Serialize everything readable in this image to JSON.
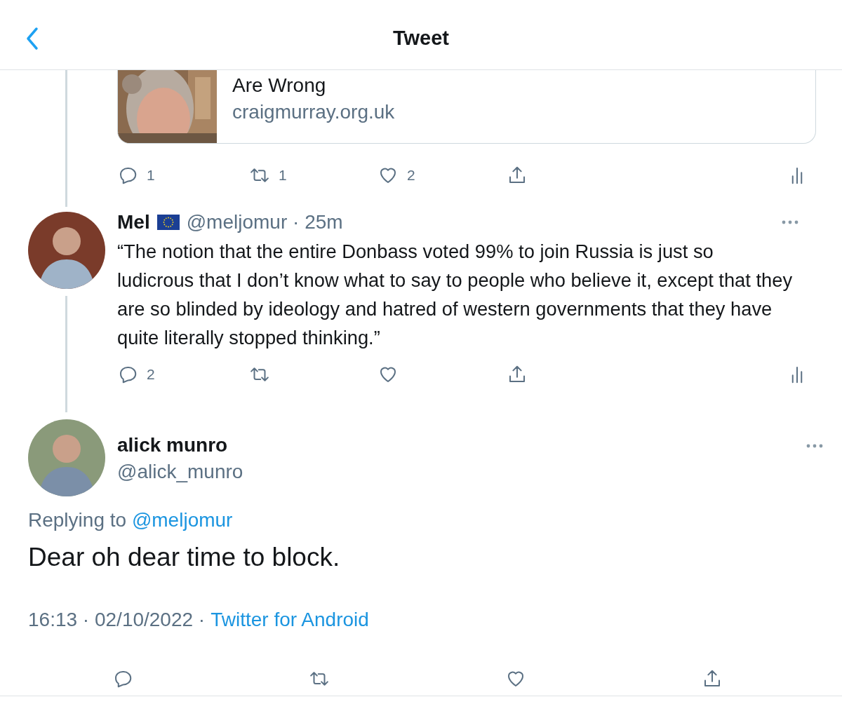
{
  "header": {
    "title": "Tweet"
  },
  "link_card": {
    "title": "Are Wrong",
    "domain": "craigmurray.org.uk"
  },
  "card_actions": [
    {
      "kind": "reply",
      "count": "1"
    },
    {
      "kind": "retweet",
      "count": "1"
    },
    {
      "kind": "like",
      "count": "2"
    },
    {
      "kind": "share"
    },
    {
      "kind": "analytics"
    }
  ],
  "parent_tweet": {
    "name": "Mel",
    "handle_time": "@meljomur · 25m",
    "text": "“The notion that the entire Donbass voted 99% to join Russia is just so ludicrous that I don’t know what to say to people who believe it, except that they are so blinded by ideology and hatred of western governments that they have quite literally stopped thinking.”",
    "actions": [
      {
        "kind": "reply",
        "count": "2"
      },
      {
        "kind": "retweet"
      },
      {
        "kind": "like"
      },
      {
        "kind": "share"
      },
      {
        "kind": "analytics"
      }
    ]
  },
  "main_tweet": {
    "name": "alick munro",
    "handle": "@alick_munro",
    "replying_label": "Replying to",
    "replying_handle": "@meljomur",
    "text": "Dear oh dear time to block.",
    "timestamp": "16:13 · 02/10/2022 ·",
    "source": "Twitter for Android",
    "actions": [
      {
        "kind": "reply"
      },
      {
        "kind": "retweet"
      },
      {
        "kind": "like"
      },
      {
        "kind": "share"
      }
    ]
  }
}
